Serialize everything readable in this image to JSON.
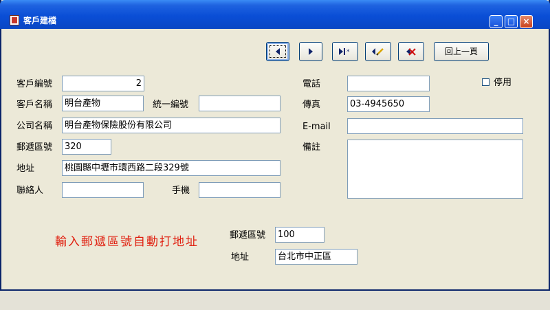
{
  "window": {
    "title": "客戶建檔"
  },
  "toolbar": {
    "back_label": "回上一頁"
  },
  "form": {
    "customer_no": {
      "label": "客戶編號",
      "value": "2"
    },
    "customer_name": {
      "label": "客戶名稱",
      "value": "明台產物"
    },
    "tax_id": {
      "label": "統一編號",
      "value": ""
    },
    "company_name": {
      "label": "公司名稱",
      "value": "明台產物保險股份有限公司"
    },
    "postal_code": {
      "label": "郵遞區號",
      "value": "320"
    },
    "address": {
      "label": "地址",
      "value": "桃園縣中壢市環西路二段329號"
    },
    "contact": {
      "label": "聯絡人",
      "value": ""
    },
    "mobile": {
      "label": "手機",
      "value": ""
    },
    "phone": {
      "label": "電話",
      "value": ""
    },
    "fax": {
      "label": "傳真",
      "value": "03-4945650"
    },
    "email": {
      "label": "E-mail",
      "value": ""
    },
    "remarks": {
      "label": "備註",
      "value": ""
    },
    "disabled": {
      "label": "停用",
      "checked": false
    }
  },
  "lookup": {
    "note": "輸入郵遞區號自動打地址",
    "postal_code": {
      "label": "郵遞區號",
      "value": "100"
    },
    "address": {
      "label": "地址",
      "value": "台北市中正區"
    }
  },
  "icons": [
    "prev-record-icon",
    "next-record-icon",
    "new-record-icon",
    "edit-record-icon",
    "delete-record-icon"
  ],
  "colors": {
    "titlebar": "#0a4ed6",
    "note_text": "#e02010",
    "window_bg": "#ece9d8"
  }
}
